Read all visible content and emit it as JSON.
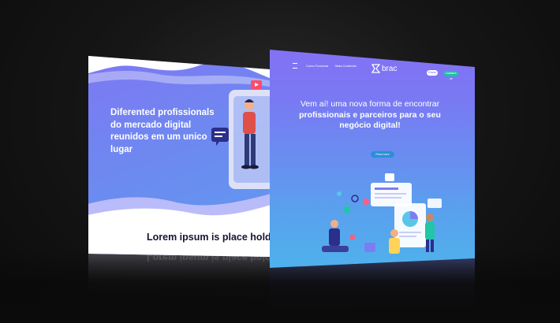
{
  "left_page": {
    "heading": "Diferented profissionals do mercado digital reunidos em um unico lugar",
    "lorem": "Lorem ipsum is place holder te"
  },
  "right_page": {
    "nav": {
      "link_1": "Como Funciona",
      "link_2": "Mais Conteúdo",
      "brand": "brac",
      "login": "Entrar",
      "cta": "Cadastre-se"
    },
    "hero_line_1": "Vem aí! uma nova forma de encontrar",
    "hero_line_2": "profissionais e parceiros para o seu",
    "hero_line_3": "negócio digital!",
    "read_more": "Read more"
  },
  "colors": {
    "background": "#111111",
    "left_gradient_start": "#8a6cf4",
    "left_gradient_end": "#4fb2ef",
    "right_gradient_start": "#8d6cf6",
    "right_gradient_end": "#44c2ea",
    "accent_green": "#17c3a4",
    "dark_text": "#161430"
  },
  "icons": [
    "brand-logo-icon",
    "chat-bubble-icon",
    "play-icon",
    "heart-icon",
    "chart-icon",
    "gear-icon",
    "person-icon"
  ]
}
